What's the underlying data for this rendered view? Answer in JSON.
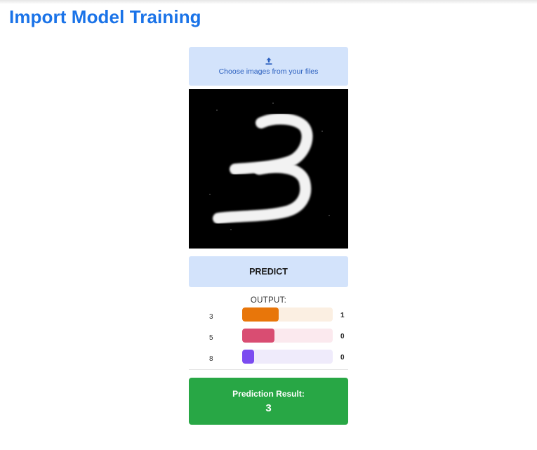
{
  "page": {
    "title": "Import Model Training"
  },
  "upload": {
    "label": "Choose images from your files",
    "icon": "upload-icon"
  },
  "preview": {
    "digit_shown": "3"
  },
  "predict": {
    "label": "PREDICT"
  },
  "output": {
    "title": "OUTPUT:",
    "rows": [
      {
        "label": "3",
        "value": "1",
        "fill_fraction": 0.4,
        "bar_color": "#e8760a",
        "track_color": "#fbefe2"
      },
      {
        "label": "5",
        "value": "0",
        "fill_fraction": 0.36,
        "bar_color": "#d94d72",
        "track_color": "#fbe9ee"
      },
      {
        "label": "8",
        "value": "0",
        "fill_fraction": 0.13,
        "bar_color": "#7b4cf0",
        "track_color": "#efebfb"
      }
    ]
  },
  "result": {
    "title": "Prediction Result:",
    "value": "3"
  },
  "colors": {
    "title_blue": "#1a73e8",
    "button_bg": "#d3e3fb",
    "result_green": "#28a745"
  }
}
